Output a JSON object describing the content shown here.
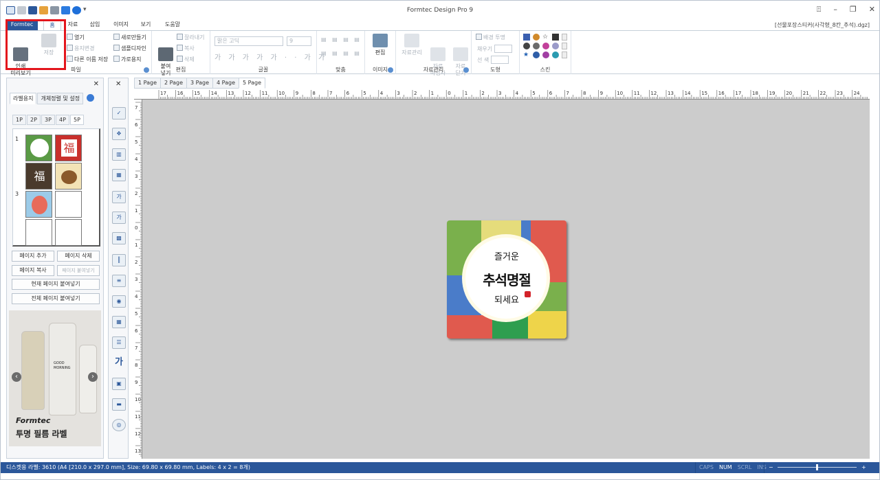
{
  "app_title": "Formtec Design Pro 9",
  "doc_name": "[선물포장스티커(사각형_8칸_추석).dgz]",
  "tabs": [
    "Formtec",
    "홈",
    "자료",
    "삽입",
    "이미지",
    "보기",
    "도움말"
  ],
  "ribbon": {
    "file": {
      "print": "인쇄\n미리보기",
      "save": "저장",
      "open": "열기",
      "change_paper": "용지변경",
      "save_as": "다른 이름 저장",
      "new": "새로만들기",
      "sample": "샘플디자인",
      "landscape": "가로용지",
      "group": "파일"
    },
    "edit": {
      "paste": "붙여\n넣기",
      "cut": "잘라내기",
      "copy": "복사",
      "delete": "삭제",
      "group": "편집"
    },
    "font": {
      "name": "맑은 고딕",
      "size": "9",
      "group": "글꼴"
    },
    "align": {
      "group": "맞춤"
    },
    "image": {
      "edit": "편집",
      "group": "이미지"
    },
    "data": {
      "manage": "자료관리",
      "wizard": "자료\n마법사",
      "close": "자료\n닫기",
      "group": "자료관리"
    },
    "shape": {
      "transparent": "배경 투명",
      "fill": "채우기",
      "line": "선   색",
      "group": "도형"
    },
    "skin": {
      "group": "스킨"
    }
  },
  "left_panel": {
    "tabs": [
      "라벨용지",
      "개체정렬 및 설정"
    ],
    "page_tabs": [
      "1P",
      "2P",
      "3P",
      "4P",
      "5P"
    ],
    "row_nums": [
      "1",
      "3"
    ],
    "buttons": {
      "add_page": "페이지 추가",
      "delete_page": "페이지 삭제",
      "copy_page": "페이지 복사",
      "paste_page": "페이지 붙여넣기",
      "paste_current": "현재 페이지 붙여넣기",
      "paste_all": "전체 페이지 붙여넣기"
    },
    "ad": {
      "brand": "Formtec",
      "text": "투명 필름 라벨",
      "bottle_text1": "GOOD",
      "bottle_text2": "MORNING"
    }
  },
  "page_tabs": [
    "1 Page",
    "2 Page",
    "3 Page",
    "4 Page",
    "5 Page"
  ],
  "ruler_h": [
    "17",
    "16",
    "15",
    "14",
    "13",
    "12",
    "11",
    "10",
    "9",
    "8",
    "7",
    "6",
    "5",
    "4",
    "3",
    "2",
    "1",
    "0",
    "1",
    "2",
    "3",
    "4",
    "5",
    "6",
    "7",
    "8",
    "9",
    "10",
    "11",
    "12",
    "13",
    "14",
    "15",
    "16",
    "17",
    "18",
    "19",
    "20",
    "21",
    "22",
    "23",
    "24"
  ],
  "ruler_v": [
    "7",
    "6",
    "5",
    "4",
    "3",
    "2",
    "1",
    "0",
    "1",
    "2",
    "3",
    "4",
    "5",
    "6",
    "7",
    "8",
    "9",
    "10",
    "11",
    "12",
    "13"
  ],
  "label": {
    "line1": "즐거운",
    "line2": "추석명절",
    "line3": "되세요"
  },
  "status": {
    "text": "디스켓용 라벨: 3610 (A4 [210.0 x 297.0 mm], Size: 69.80 x 69.80 mm,  Labels: 4 x 2 = 8개)",
    "keys": [
      "CAPS",
      "NUM",
      "SCRL",
      "INS"
    ],
    "zoom_minus": "−",
    "zoom_plus": "+"
  }
}
